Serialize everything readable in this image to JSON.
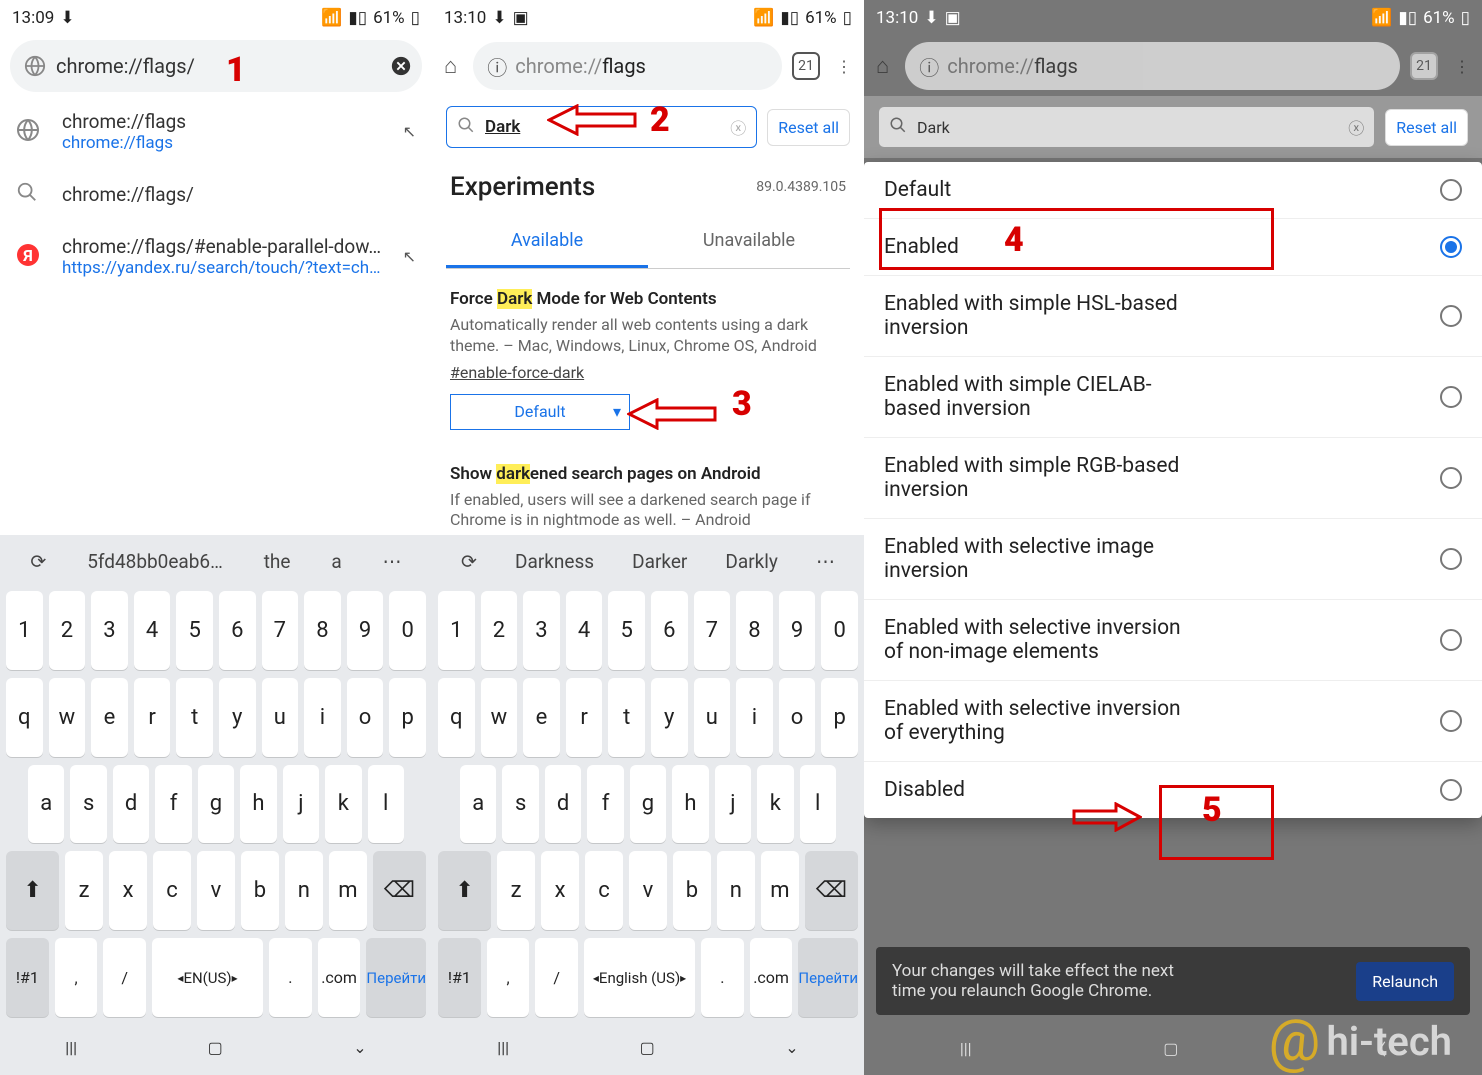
{
  "panes": {
    "p1": {
      "status": {
        "time": "13:09",
        "battery": "61%"
      },
      "omnibox": "chrome://flags/",
      "suggestions": [
        {
          "icon": "globe",
          "line1": "chrome://flags",
          "line2": "chrome://flags",
          "arrow": true
        },
        {
          "icon": "magnify",
          "line1": "chrome://flags/",
          "line2": "",
          "arrow": false
        },
        {
          "icon": "yandex",
          "line1": "chrome://flags/#enable-parallel-dow…",
          "line2": "https://yandex.ru/search/touch/?text=chr…",
          "arrow": true
        }
      ],
      "annotation": {
        "num": "1"
      }
    },
    "p2": {
      "status": {
        "time": "13:10",
        "battery": "61%"
      },
      "url": "chrome://flags",
      "tabcount": "21",
      "search": "Dark",
      "reset": "Reset all",
      "experimentsTitle": "Experiments",
      "version": "89.0.4389.105",
      "tabs": {
        "available": "Available",
        "unavailable": "Unavailable"
      },
      "flag1": {
        "titlePre": "Force ",
        "titleHL": "Dark",
        "titlePost": " Mode for Web Contents",
        "desc": "Automatically render all web contents using a dark theme. – Mac, Windows, Linux, Chrome OS, Android",
        "anchor": "#enable-force-dark",
        "select": "Default"
      },
      "flag2": {
        "titlePre": "Show ",
        "titleHL": "dark",
        "titlePost": "ened search pages on Android",
        "desc": "If enabled, users will see a darkened search page if Chrome is in nightmode as well. – Android"
      },
      "kbSug": [
        "Darkness",
        "Darker",
        "Darkly"
      ],
      "annotation": {
        "num2": "2",
        "num3": "3"
      }
    },
    "p3": {
      "status": {
        "time": "13:10",
        "battery": "61%"
      },
      "url": "chrome://flags",
      "tabcount": "21",
      "search": "Dark",
      "reset": "Reset all",
      "menu": [
        "Default",
        "Enabled",
        "Enabled with simple HSL-based inversion",
        "Enabled with simple CIELAB-based inversion",
        "Enabled with simple RGB-based inversion",
        "Enabled with selective image inversion",
        "Enabled with selective inversion of non-image elements",
        "Enabled with selective inversion of everything",
        "Disabled"
      ],
      "selectedIdx": 1,
      "snack": "Your changes will take effect the next time you relaunch Google Chrome.",
      "relaunch": "Relaunch",
      "watermark": "hi-tech",
      "annotation": {
        "num4": "4",
        "num5": "5"
      }
    },
    "keyboard": {
      "p1": {
        "sug": [
          "5fd48bb0eab6…",
          "the",
          "a"
        ],
        "row4": {
          "sym": "!#1",
          "comma": ",",
          "slash": "/",
          "lang": "EN(US)",
          "dot": ".",
          "com": ".com",
          "go": "Перейти"
        }
      },
      "p2": {
        "row4": {
          "sym": "!#1",
          "comma": ",",
          "slash": "/",
          "lang": "English (US)",
          "dot": ".",
          "com": ".com",
          "go": "Перейти"
        }
      },
      "rows": {
        "r1": [
          "1",
          "2",
          "3",
          "4",
          "5",
          "6",
          "7",
          "8",
          "9",
          "0"
        ],
        "r2": [
          "q",
          "w",
          "e",
          "r",
          "t",
          "y",
          "u",
          "i",
          "o",
          "p"
        ],
        "r3": [
          "a",
          "s",
          "d",
          "f",
          "g",
          "h",
          "j",
          "k",
          "l"
        ],
        "r4": [
          "z",
          "x",
          "c",
          "v",
          "b",
          "n",
          "m"
        ]
      }
    }
  }
}
